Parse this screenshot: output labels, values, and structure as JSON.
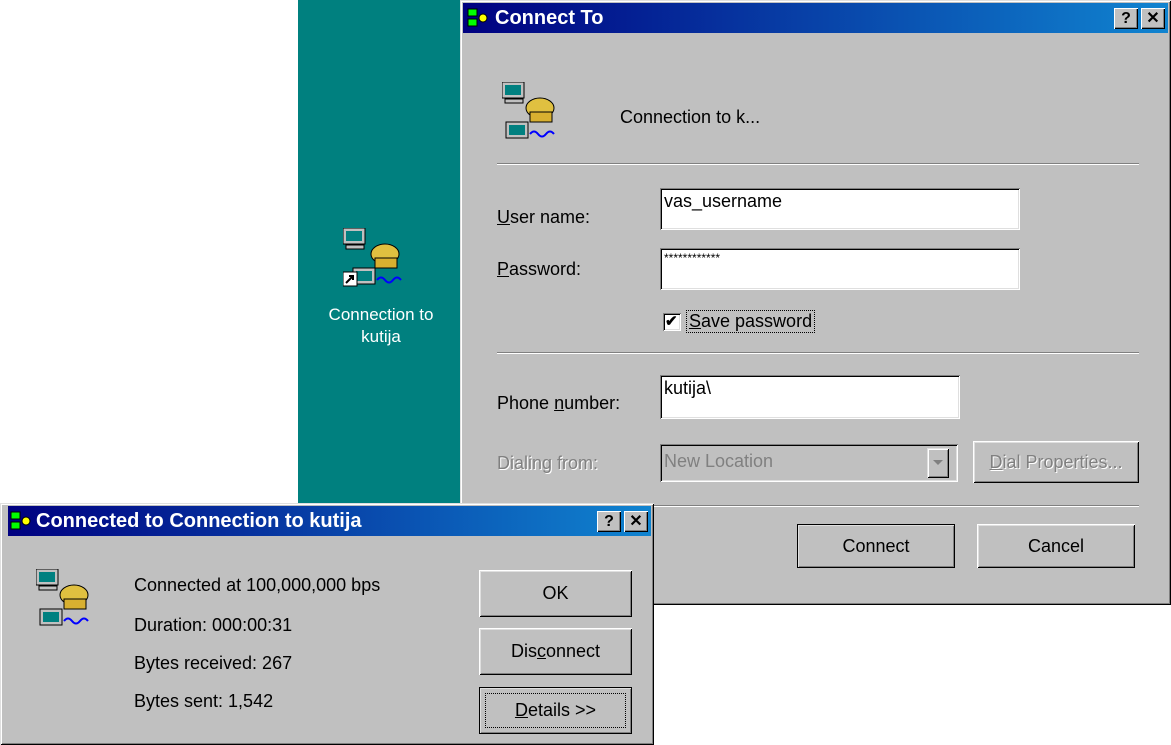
{
  "desktop": {
    "icon_label_line1": "Connection to",
    "icon_label_line2": "kutija"
  },
  "connect_dialog": {
    "title": "Connect To",
    "help_label": "?",
    "close_label": "✕",
    "connection_name": "Connection to k...",
    "username_label_u": "U",
    "username_label_rest": "ser name:",
    "username_value": "vas_username",
    "password_label_p": "P",
    "password_label_rest": "assword:",
    "password_value": "************",
    "save_password_s": "S",
    "save_password_rest": "ave password",
    "save_password_checked": "✔",
    "phone_label_pre": "Phone ",
    "phone_label_n": "n",
    "phone_label_post": "umber:",
    "phone_value": "kutija\\",
    "dialing_from_label": "Dialing from:",
    "dialing_from_value": "New Location",
    "dial_properties_d": "D",
    "dial_properties_rest": "ial Properties...",
    "connect_label": "Connect",
    "cancel_label": "Cancel"
  },
  "status_dialog": {
    "title": "Connected to Connection to kutija",
    "help_label": "?",
    "close_label": "✕",
    "speed": "Connected at 100,000,000 bps",
    "duration": "Duration:  000:00:31",
    "bytes_received": "Bytes received:  267",
    "bytes_sent": "Bytes sent:  1,542",
    "ok_label": "OK",
    "disconnect_pre": "Dis",
    "disconnect_c": "c",
    "disconnect_post": "onnect",
    "details_d": "D",
    "details_rest": "etails >>"
  },
  "icons": {
    "connection": "dial-up-connection-icon",
    "shortcut": "shortcut-arrow-icon"
  },
  "colors": {
    "desktop": "#00807f",
    "titlebar_start": "#000080",
    "titlebar_end": "#1084d0",
    "window_face": "#c0c0c0"
  }
}
